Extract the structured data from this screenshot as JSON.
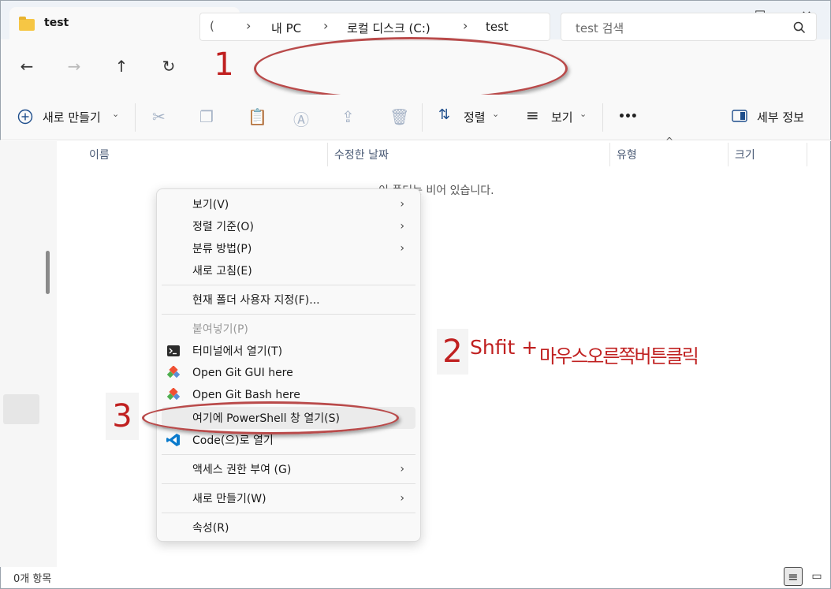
{
  "window": {
    "tab_title": "test",
    "new_tab": "+",
    "controls": {
      "minimize": "—",
      "maximize": "☐",
      "close": "✕"
    }
  },
  "nav": {
    "address": {
      "root": "내 PC",
      "drive": "로컬 디스크 (C:)",
      "folder": "test",
      "sep": "›",
      "start": "(",
      "lead_sep": "›"
    },
    "search_placeholder": "test 검색"
  },
  "toolbar": {
    "new_label": "새로 만들기",
    "sort_label": "정렬",
    "view_label": "보기",
    "more_label": "•••",
    "details_label": "세부 정보"
  },
  "columns": [
    {
      "label": "이름"
    },
    {
      "label": "수정한 날짜"
    },
    {
      "label": "유형"
    },
    {
      "label": "크기"
    }
  ],
  "empty_message": "이 폴더는 비어 있습니다.",
  "sort_indicator": "^",
  "context_menu": {
    "items": [
      {
        "label": "보기(V)",
        "arrow": "›"
      },
      {
        "label": "정렬 기준(O)",
        "arrow": "›"
      },
      {
        "label": "분류 방법(P)",
        "arrow": "›"
      },
      {
        "label": "새로 고침(E)"
      },
      {
        "label": "현재 폴더 사용자 지정(F)..."
      },
      {
        "label": "붙여넣기(P)"
      },
      {
        "label": "터미널에서 열기(T)"
      },
      {
        "label": "Open Git GUI here"
      },
      {
        "label": "Open Git Bash here"
      },
      {
        "label": "여기에 PowerShell 창 열기(S)"
      },
      {
        "label": "Code(으)로 열기"
      },
      {
        "label": "액세스 권한 부여 (G)",
        "arrow": "›"
      },
      {
        "label": "새로 만들기(W)",
        "arrow": "›"
      },
      {
        "label": "속성(R)"
      }
    ]
  },
  "annotations": {
    "step1": "1",
    "step2": "2",
    "step3": "3",
    "step2_text_a": "Shfit +",
    "step2_text_b": "마우스오른쪽버튼클릭"
  },
  "status": {
    "item_count": "0개 항목"
  },
  "colors": {
    "accent": "#0067c0",
    "annotation": "#c02020",
    "folder": "#f6c644"
  }
}
